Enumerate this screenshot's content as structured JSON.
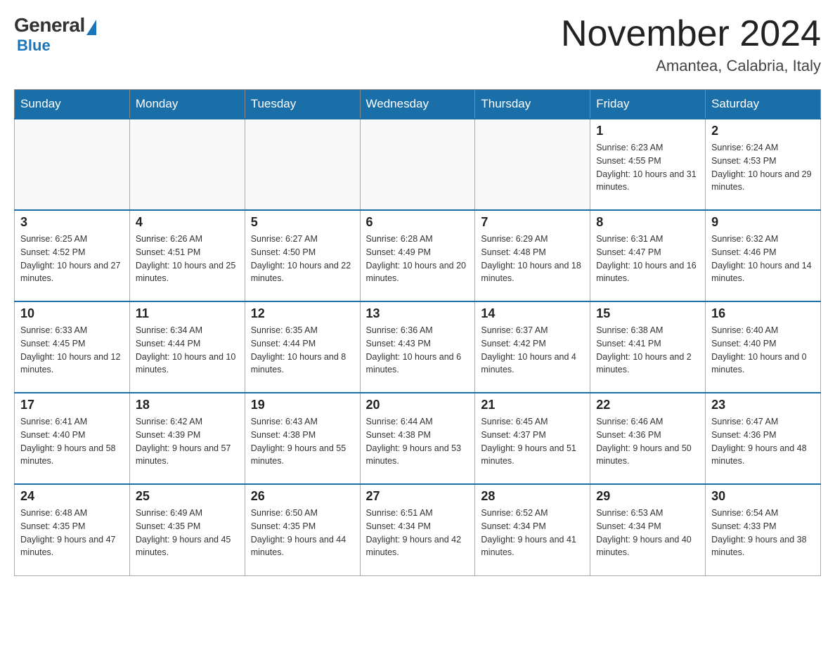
{
  "logo": {
    "general": "General",
    "blue": "Blue"
  },
  "title": {
    "month": "November 2024",
    "location": "Amantea, Calabria, Italy"
  },
  "weekdays": [
    "Sunday",
    "Monday",
    "Tuesday",
    "Wednesday",
    "Thursday",
    "Friday",
    "Saturday"
  ],
  "weeks": [
    [
      {
        "day": "",
        "info": ""
      },
      {
        "day": "",
        "info": ""
      },
      {
        "day": "",
        "info": ""
      },
      {
        "day": "",
        "info": ""
      },
      {
        "day": "",
        "info": ""
      },
      {
        "day": "1",
        "info": "Sunrise: 6:23 AM\nSunset: 4:55 PM\nDaylight: 10 hours and 31 minutes."
      },
      {
        "day": "2",
        "info": "Sunrise: 6:24 AM\nSunset: 4:53 PM\nDaylight: 10 hours and 29 minutes."
      }
    ],
    [
      {
        "day": "3",
        "info": "Sunrise: 6:25 AM\nSunset: 4:52 PM\nDaylight: 10 hours and 27 minutes."
      },
      {
        "day": "4",
        "info": "Sunrise: 6:26 AM\nSunset: 4:51 PM\nDaylight: 10 hours and 25 minutes."
      },
      {
        "day": "5",
        "info": "Sunrise: 6:27 AM\nSunset: 4:50 PM\nDaylight: 10 hours and 22 minutes."
      },
      {
        "day": "6",
        "info": "Sunrise: 6:28 AM\nSunset: 4:49 PM\nDaylight: 10 hours and 20 minutes."
      },
      {
        "day": "7",
        "info": "Sunrise: 6:29 AM\nSunset: 4:48 PM\nDaylight: 10 hours and 18 minutes."
      },
      {
        "day": "8",
        "info": "Sunrise: 6:31 AM\nSunset: 4:47 PM\nDaylight: 10 hours and 16 minutes."
      },
      {
        "day": "9",
        "info": "Sunrise: 6:32 AM\nSunset: 4:46 PM\nDaylight: 10 hours and 14 minutes."
      }
    ],
    [
      {
        "day": "10",
        "info": "Sunrise: 6:33 AM\nSunset: 4:45 PM\nDaylight: 10 hours and 12 minutes."
      },
      {
        "day": "11",
        "info": "Sunrise: 6:34 AM\nSunset: 4:44 PM\nDaylight: 10 hours and 10 minutes."
      },
      {
        "day": "12",
        "info": "Sunrise: 6:35 AM\nSunset: 4:44 PM\nDaylight: 10 hours and 8 minutes."
      },
      {
        "day": "13",
        "info": "Sunrise: 6:36 AM\nSunset: 4:43 PM\nDaylight: 10 hours and 6 minutes."
      },
      {
        "day": "14",
        "info": "Sunrise: 6:37 AM\nSunset: 4:42 PM\nDaylight: 10 hours and 4 minutes."
      },
      {
        "day": "15",
        "info": "Sunrise: 6:38 AM\nSunset: 4:41 PM\nDaylight: 10 hours and 2 minutes."
      },
      {
        "day": "16",
        "info": "Sunrise: 6:40 AM\nSunset: 4:40 PM\nDaylight: 10 hours and 0 minutes."
      }
    ],
    [
      {
        "day": "17",
        "info": "Sunrise: 6:41 AM\nSunset: 4:40 PM\nDaylight: 9 hours and 58 minutes."
      },
      {
        "day": "18",
        "info": "Sunrise: 6:42 AM\nSunset: 4:39 PM\nDaylight: 9 hours and 57 minutes."
      },
      {
        "day": "19",
        "info": "Sunrise: 6:43 AM\nSunset: 4:38 PM\nDaylight: 9 hours and 55 minutes."
      },
      {
        "day": "20",
        "info": "Sunrise: 6:44 AM\nSunset: 4:38 PM\nDaylight: 9 hours and 53 minutes."
      },
      {
        "day": "21",
        "info": "Sunrise: 6:45 AM\nSunset: 4:37 PM\nDaylight: 9 hours and 51 minutes."
      },
      {
        "day": "22",
        "info": "Sunrise: 6:46 AM\nSunset: 4:36 PM\nDaylight: 9 hours and 50 minutes."
      },
      {
        "day": "23",
        "info": "Sunrise: 6:47 AM\nSunset: 4:36 PM\nDaylight: 9 hours and 48 minutes."
      }
    ],
    [
      {
        "day": "24",
        "info": "Sunrise: 6:48 AM\nSunset: 4:35 PM\nDaylight: 9 hours and 47 minutes."
      },
      {
        "day": "25",
        "info": "Sunrise: 6:49 AM\nSunset: 4:35 PM\nDaylight: 9 hours and 45 minutes."
      },
      {
        "day": "26",
        "info": "Sunrise: 6:50 AM\nSunset: 4:35 PM\nDaylight: 9 hours and 44 minutes."
      },
      {
        "day": "27",
        "info": "Sunrise: 6:51 AM\nSunset: 4:34 PM\nDaylight: 9 hours and 42 minutes."
      },
      {
        "day": "28",
        "info": "Sunrise: 6:52 AM\nSunset: 4:34 PM\nDaylight: 9 hours and 41 minutes."
      },
      {
        "day": "29",
        "info": "Sunrise: 6:53 AM\nSunset: 4:34 PM\nDaylight: 9 hours and 40 minutes."
      },
      {
        "day": "30",
        "info": "Sunrise: 6:54 AM\nSunset: 4:33 PM\nDaylight: 9 hours and 38 minutes."
      }
    ]
  ]
}
